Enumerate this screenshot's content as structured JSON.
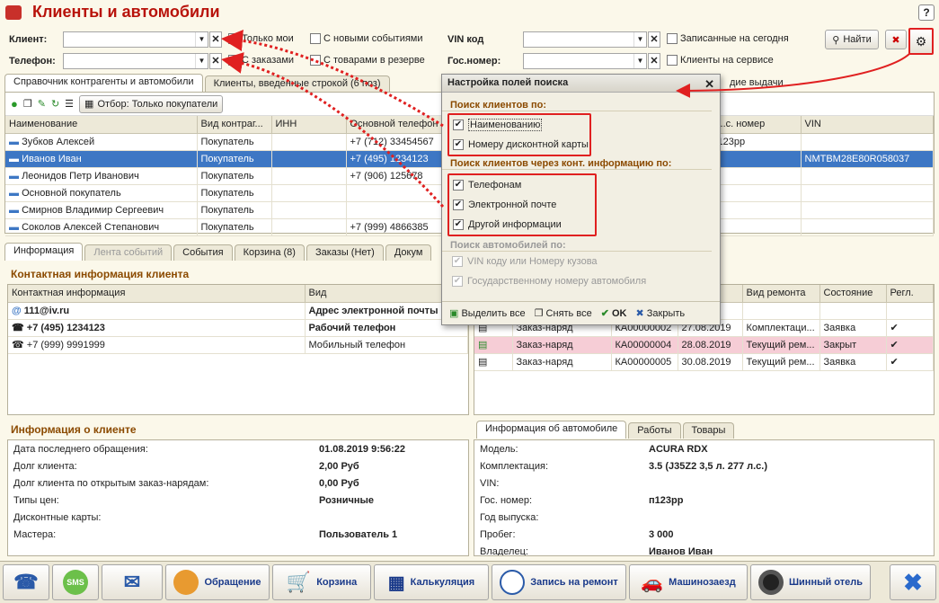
{
  "app": {
    "title": "Клиенты и автомобили",
    "help": "?"
  },
  "filters": {
    "client_label": "Клиент:",
    "phone_label": "Телефон:",
    "vin_label": "VIN код",
    "gosnomer_label": "Гос.номер:",
    "only_mine": "Только мои",
    "with_new_events": "С новыми событиями",
    "with_orders": "С заказами",
    "goods_reserved": "С товарами в резерве",
    "recorded_today": "Записанные на сегодня",
    "clients_on_service": "Клиенты на сервисе",
    "find": "Найти",
    "issue_partial": "дие выдачи"
  },
  "tabs_top": [
    "Справочник контрагенты и автомобили",
    "Клиенты, введенные строкой (6 поз)"
  ],
  "toolbar": {
    "filter_btn": "Отбор: Только покупатели"
  },
  "clients_table": {
    "headers": [
      "Наименование",
      "Вид контраг...",
      "ИНН",
      "Основной телефон",
      "...с. номер",
      "VIN"
    ],
    "rows": [
      {
        "name": "Зубков Алексей",
        "type": "Покупатель",
        "inn": "",
        "phone": "+7 (712) 33454567",
        "num": "123рр",
        "vin": ""
      },
      {
        "name": "Иванов Иван",
        "type": "Покупатель",
        "inn": "",
        "phone": "+7 (495) 1234123",
        "num": "",
        "vin": "NMTBM28E80R058037"
      },
      {
        "name": "Леонидов Петр Иванович",
        "type": "Покупатель",
        "inn": "",
        "phone": "+7 (906) 125678",
        "num": "",
        "vin": ""
      },
      {
        "name": "Основной покупатель",
        "type": "Покупатель",
        "inn": "",
        "phone": "",
        "num": "",
        "vin": ""
      },
      {
        "name": "Смирнов Владимир Сергеевич",
        "type": "Покупатель",
        "inn": "",
        "phone": "",
        "num": "",
        "vin": ""
      },
      {
        "name": "Соколов Алексей Степанович",
        "type": "Покупатель",
        "inn": "",
        "phone": "+7 (999) 4866385",
        "num": "",
        "vin": ""
      }
    ]
  },
  "tabs_mid": [
    "Информация",
    "Лента событий",
    "События",
    "Корзина (8)",
    "Заказы (Нет)",
    "Докум"
  ],
  "contact": {
    "section": "Контактная информация клиента",
    "headers": [
      "Контактная информация",
      "Вид"
    ],
    "rows": [
      {
        "value": "111@iv.ru",
        "kind": "Адрес электронной почты"
      },
      {
        "value": "+7 (495) 1234123",
        "kind": "Рабочий телефон"
      },
      {
        "value": "+7 (999) 9991999",
        "kind": "Мобильный телефон"
      }
    ]
  },
  "orders": {
    "headers": [
      "",
      "",
      "",
      "",
      "Вид ремонта",
      "Состояние",
      "Регл."
    ],
    "rows": [
      {
        "doc": "",
        "num": "",
        "date": "...019",
        "rep": "",
        "state": "",
        "ch": ""
      },
      {
        "doc": "Заказ-наряд",
        "num": "КА00000002",
        "date": "27.08.2019",
        "rep": "Комплектаци...",
        "state": "Заявка",
        "ch": "✔"
      },
      {
        "doc": "Заказ-наряд",
        "num": "КА00000004",
        "date": "28.08.2019",
        "rep": "Текущий рем...",
        "state": "Закрыт",
        "ch": "✔"
      },
      {
        "doc": "Заказ-наряд",
        "num": "КА00000005",
        "date": "30.08.2019",
        "rep": "Текущий рем...",
        "state": "Заявка",
        "ch": "✔"
      }
    ]
  },
  "client_info": {
    "section": "Информация о клиенте",
    "rows": [
      {
        "k": "Дата последнего обращения:",
        "v": "01.08.2019 9:56:22"
      },
      {
        "k": "Долг клиента:",
        "v": "2,00 Руб"
      },
      {
        "k": "Долг клиента по открытым заказ-нарядам:",
        "v": "0,00 Руб"
      },
      {
        "k": "Типы цен:",
        "v": "Розничные"
      },
      {
        "k": "Дисконтные карты:",
        "v": ""
      },
      {
        "k": "Мастера:",
        "v": "Пользователь 1"
      }
    ]
  },
  "car_tabs": [
    "Информация об автомобиле",
    "Работы",
    "Товары"
  ],
  "car_info": {
    "rows": [
      {
        "k": "Модель:",
        "v": "ACURA RDX"
      },
      {
        "k": "Комплектация:",
        "v": "3.5 (J35Z2 3,5 л. 277 л.с.)"
      },
      {
        "k": "VIN:",
        "v": ""
      },
      {
        "k": "Гос. номер:",
        "v": "п123рр"
      },
      {
        "k": "Год выпуска:",
        "v": ""
      },
      {
        "k": "Пробег:",
        "v": "3 000"
      },
      {
        "k": "Владелец:",
        "v": "Иванов Иван"
      }
    ]
  },
  "dialog": {
    "title": "Настройка полей поиска",
    "sec1": "Поиск клиентов по:",
    "opt1": "Наименованию",
    "opt2": "Номеру дисконтной карты",
    "sec2": "Поиск клиентов через конт. информацию по:",
    "opt3": "Телефонам",
    "opt4": "Электронной почте",
    "opt5": "Другой информации",
    "sec3": "Поиск автомобилей по:",
    "opt6": "VIN коду или Номеру кузова",
    "opt7": "Государственному номеру автомобиля",
    "select_all": "Выделить все",
    "clear_all": "Снять все",
    "ok": "OK",
    "close": "Закрыть"
  },
  "bottom": {
    "obr": "Обращение",
    "korz": "Корзина",
    "kalk": "Калькуляция",
    "zap": "Запись на ремонт",
    "mash": "Машинозаезд",
    "shin": "Шинный отель"
  },
  "colors": {
    "accent": "#b8120a",
    "selected": "#3d77c4",
    "highlight_red": "#e02020"
  }
}
